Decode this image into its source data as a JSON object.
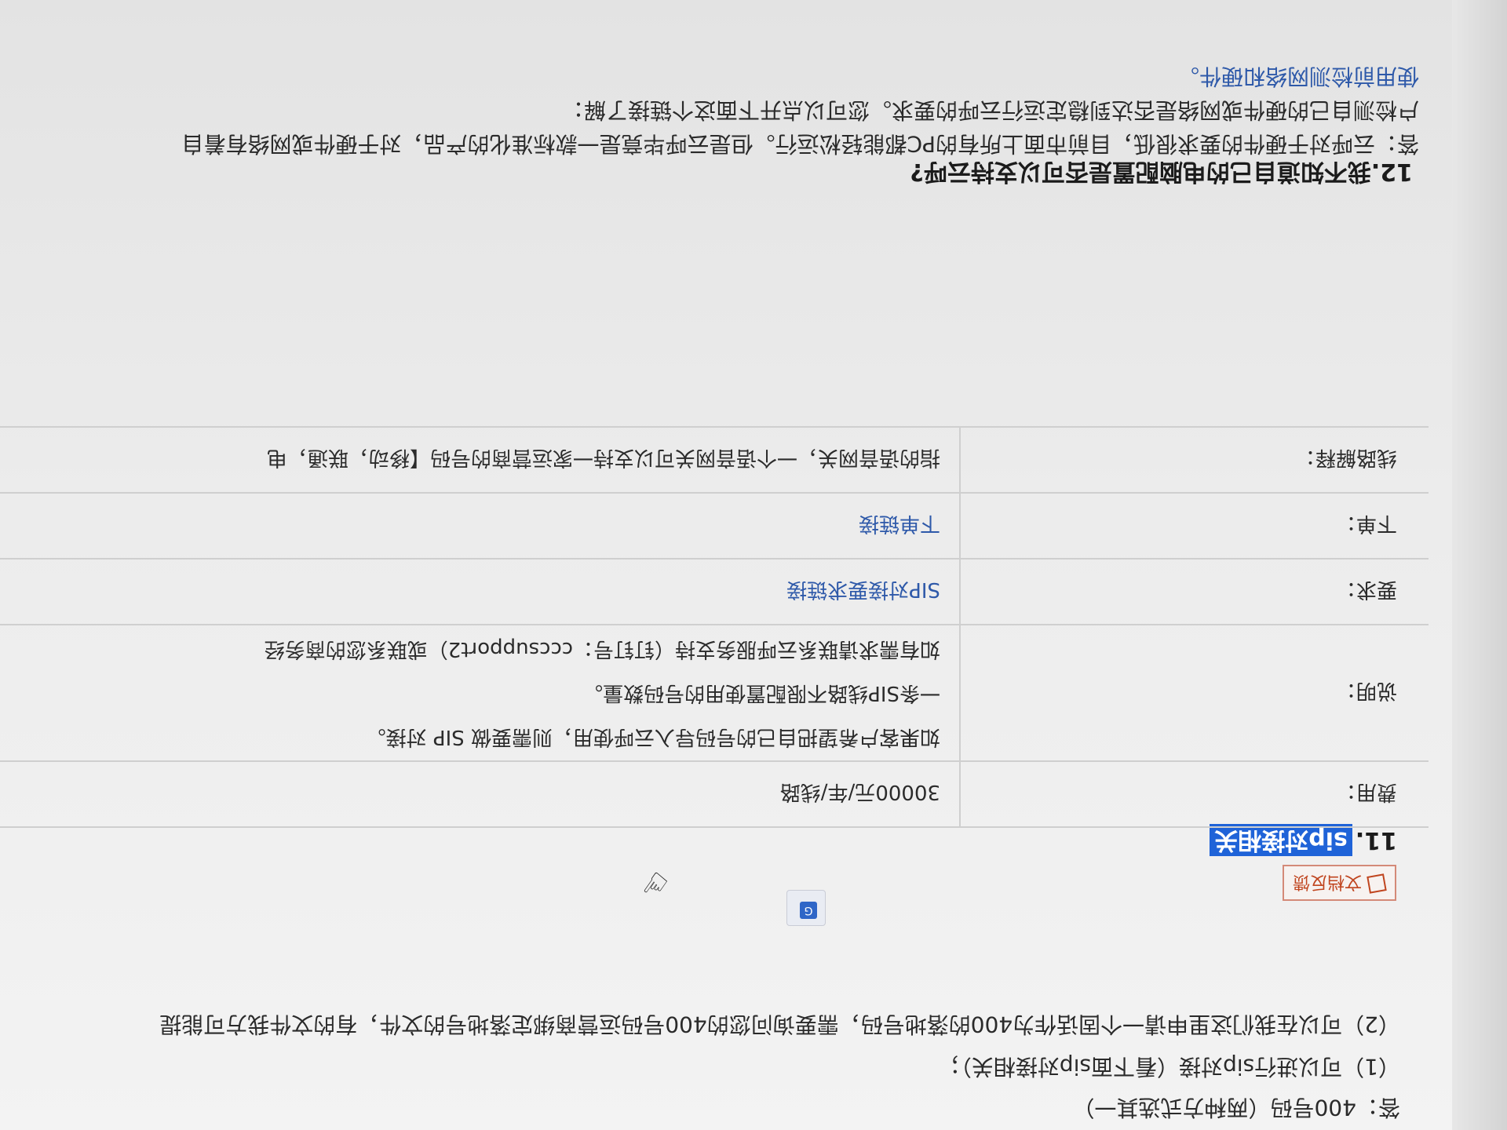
{
  "intro": {
    "answer_400": "答：400号码（两种方式选其一）",
    "option_1": "（1）可以进行sip对接（看下面sip对接相关）；",
    "option_2": "（2）可以在我们这里申请一个固话作为400的落地号码，需要询问您的400号码运营商绑定落地号的文件，有的文件我方可能提"
  },
  "feedback_button_label": "文档反馈",
  "translate_icon_glyph": "G",
  "section11": {
    "number": "11.",
    "title": "sip对接相关",
    "rows": [
      {
        "key": "费用：",
        "value": "30000元/年/线路"
      },
      {
        "key": "说明：",
        "lines": [
          "如果客户希望把自己的号码导入云呼使用，则需要做 SIP 对接。",
          "一条SIP线路不限配置使用的号码数量。",
          "如有需求请联系云呼服务支持（钉钉号：cccsupport2）或联系您的商务经"
        ]
      },
      {
        "key": "要求：",
        "link": "SIP对接要求链接"
      },
      {
        "key": "下单：",
        "link": "下单链接"
      },
      {
        "key": "线路解释：",
        "value": "指的语音网关，一个语音网关可以支持一家运营商的号码【移动，联通，电"
      }
    ]
  },
  "section12": {
    "title": "12.我不知道自己的电脑配置是否可以支持云呼?",
    "answer": "答：云呼对于硬件的要求很低，目前市面上所有的PC都能轻松运行。但是云呼毕竟是一款标准化的产品，对于硬件或网络有着自",
    "line2": "户检测自己的硬件或网络是否达到稳定运行云呼的要求。您可以点开下面这个链接了解：",
    "link": "使用前检测网络和硬件。"
  }
}
